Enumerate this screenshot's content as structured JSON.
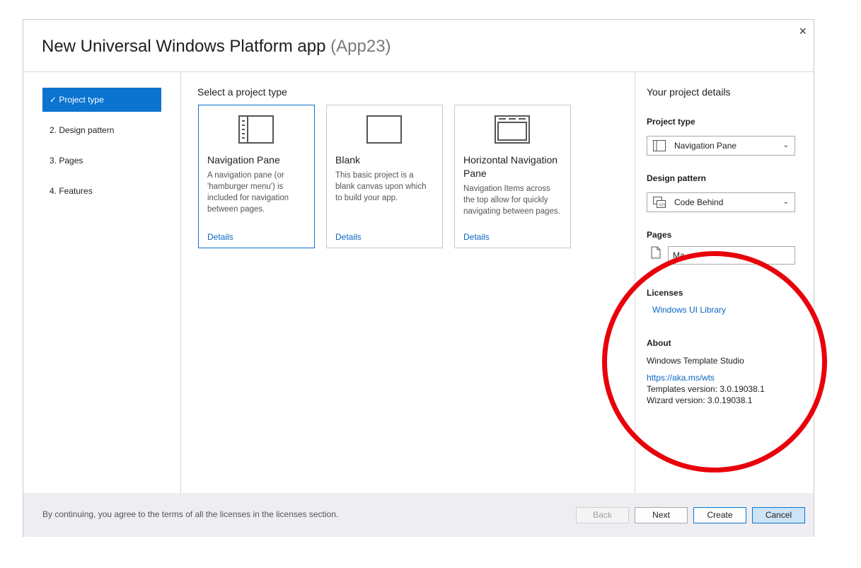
{
  "window": {
    "title": "New Universal Windows Platform app",
    "subtitle": "(App23)",
    "close_label": "×"
  },
  "steps": [
    {
      "label": "✓ Project type",
      "active": true
    },
    {
      "label": "2.  Design pattern",
      "active": false
    },
    {
      "label": "3.  Pages",
      "active": false
    },
    {
      "label": "4.  Features",
      "active": false
    }
  ],
  "main": {
    "section_title": "Select a project type",
    "cards": [
      {
        "name": "Navigation Pane",
        "description": "A navigation pane (or 'hamburger menu') is included for navigation between pages.",
        "details": "Details",
        "icon": "navigation-pane-icon",
        "selected": true
      },
      {
        "name": "Blank",
        "description": "This basic project is a blank canvas upon which to build your app.",
        "details": "Details",
        "icon": "blank-icon",
        "selected": false
      },
      {
        "name": "Horizontal Navigation Pane",
        "description": "Navigation Items across the top allow for quickly navigating between pages.",
        "details": "Details",
        "icon": "horizontal-navigation-icon",
        "selected": false
      }
    ]
  },
  "details": {
    "heading": "Your project details",
    "project_type_label": "Project type",
    "project_type_value": "Navigation Pane",
    "design_pattern_label": "Design pattern",
    "design_pattern_value": "Code Behind",
    "pages_label": "Pages",
    "page_name": "Ma",
    "licenses_label": "Licenses",
    "license_link": "Windows UI Library",
    "about_label": "About",
    "about_name": "Windows Template Studio",
    "about_link": "https://aka.ms/wts",
    "templates_version": "Templates version: 3.0.19038.1",
    "wizard_version": "Wizard version: 3.0.19038.1"
  },
  "footer": {
    "agree_text": "By continuing, you agree to the terms of all the licenses in the licenses section.",
    "back": "Back",
    "next": "Next",
    "create": "Create",
    "cancel": "Cancel"
  },
  "colors": {
    "accent": "#0a74d0",
    "annotation_circle": "#e8000b"
  }
}
